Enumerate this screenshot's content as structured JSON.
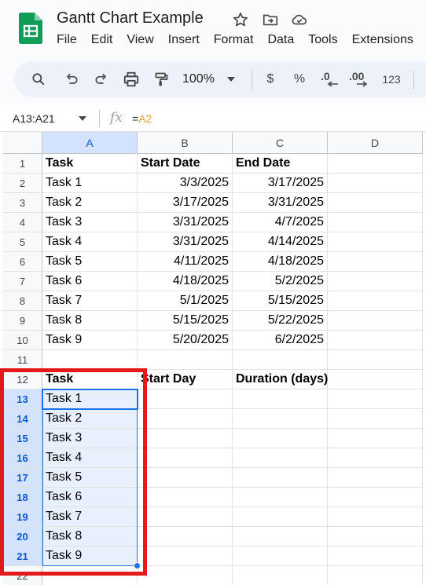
{
  "app": {
    "doc_title": "Gantt Chart Example",
    "menu": [
      "File",
      "Edit",
      "View",
      "Insert",
      "Format",
      "Data",
      "Tools",
      "Extensions"
    ]
  },
  "toolbar": {
    "zoom": "100%",
    "currency": "$",
    "percent": "%",
    "decrease_decimal": ".0",
    "increase_decimal": ".00",
    "number_format": "123"
  },
  "formula_bar": {
    "name_box": "A13:A21",
    "formula_eq": "=",
    "formula_ref": "A2"
  },
  "grid": {
    "columns": [
      "A",
      "B",
      "C",
      "D"
    ],
    "rows": [
      {
        "num": "1",
        "a": "Task",
        "b": "Start Date",
        "c": "End Date"
      },
      {
        "num": "2",
        "a": "Task 1",
        "b": "3/3/2025",
        "c": "3/17/2025"
      },
      {
        "num": "3",
        "a": "Task 2",
        "b": "3/17/2025",
        "c": "3/31/2025"
      },
      {
        "num": "4",
        "a": "Task 3",
        "b": "3/31/2025",
        "c": "4/7/2025"
      },
      {
        "num": "5",
        "a": "Task 4",
        "b": "3/31/2025",
        "c": "4/14/2025"
      },
      {
        "num": "6",
        "a": "Task 5",
        "b": "4/11/2025",
        "c": "4/18/2025"
      },
      {
        "num": "7",
        "a": "Task 6",
        "b": "4/18/2025",
        "c": "5/2/2025"
      },
      {
        "num": "8",
        "a": "Task 7",
        "b": "5/1/2025",
        "c": "5/15/2025"
      },
      {
        "num": "9",
        "a": "Task 8",
        "b": "5/15/2025",
        "c": "5/22/2025"
      },
      {
        "num": "10",
        "a": "Task 9",
        "b": "5/20/2025",
        "c": "6/2/2025"
      },
      {
        "num": "11",
        "a": "",
        "b": "",
        "c": ""
      },
      {
        "num": "12",
        "a": "Task",
        "b": "Start Day",
        "c": "Duration (days)"
      },
      {
        "num": "13",
        "a": "Task 1",
        "b": "",
        "c": ""
      },
      {
        "num": "14",
        "a": "Task 2",
        "b": "",
        "c": ""
      },
      {
        "num": "15",
        "a": "Task 3",
        "b": "",
        "c": ""
      },
      {
        "num": "16",
        "a": "Task 4",
        "b": "",
        "c": ""
      },
      {
        "num": "17",
        "a": "Task 5",
        "b": "",
        "c": ""
      },
      {
        "num": "18",
        "a": "Task 6",
        "b": "",
        "c": ""
      },
      {
        "num": "19",
        "a": "Task 7",
        "b": "",
        "c": ""
      },
      {
        "num": "20",
        "a": "Task 8",
        "b": "",
        "c": ""
      },
      {
        "num": "21",
        "a": "Task 9",
        "b": "",
        "c": ""
      },
      {
        "num": "22",
        "a": "",
        "b": "",
        "c": ""
      }
    ]
  },
  "colors": {
    "sheets_green": "#0f9d58",
    "selection_blue": "#1a73e8",
    "highlight_red": "#e3191b"
  }
}
